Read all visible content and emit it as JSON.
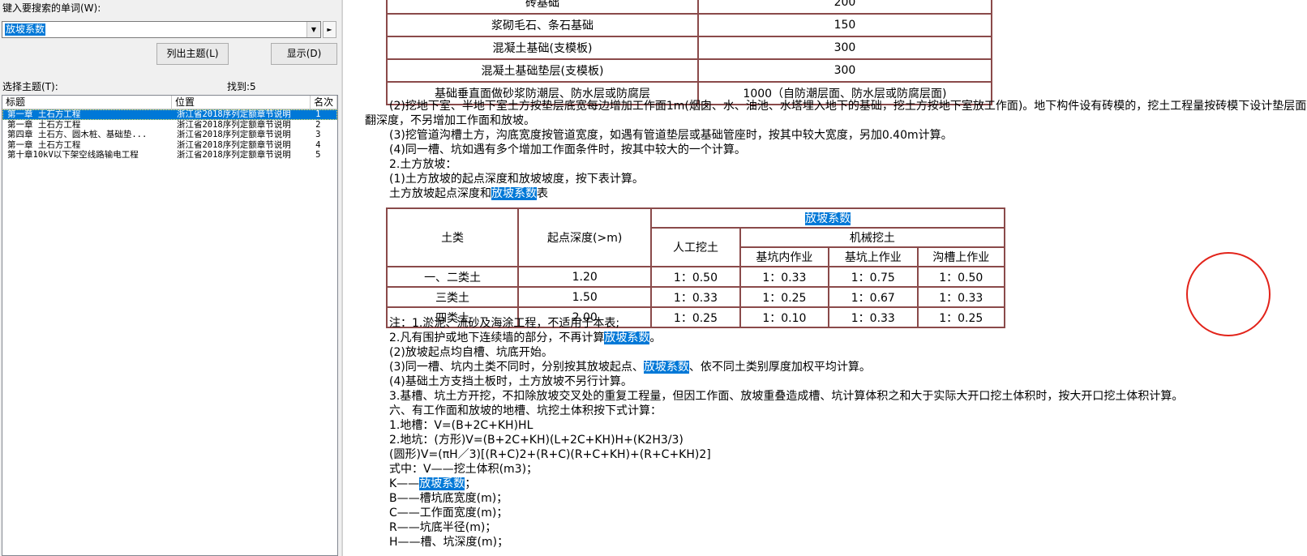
{
  "search": {
    "prompt_label": "键入要搜索的单词(W):",
    "query_value": "放坡系数",
    "dropdown_glyph": "▼",
    "next_glyph": "►",
    "list_topics_button": "列出主题(L)",
    "display_button": "显示(D)"
  },
  "topics": {
    "label": "选择主题(T):",
    "found": "找到:5",
    "columns": [
      "标题",
      "位置",
      "名次"
    ],
    "rows": [
      {
        "title": "第一章 土石方工程",
        "location": "浙江省2018序列定额章节说明",
        "rank": "1",
        "selected": true
      },
      {
        "title": "第一章 土石方工程",
        "location": "浙江省2018序列定额章节说明",
        "rank": "2",
        "selected": false
      },
      {
        "title": "第四章 土石方、圆木桩、基础垫...",
        "location": "浙江省2018序列定额章节说明",
        "rank": "3",
        "selected": false
      },
      {
        "title": "第一章 土石方工程",
        "location": "浙江省2018序列定额章节说明",
        "rank": "4",
        "selected": false
      },
      {
        "title": "第十章10kV以下架空线路输电工程",
        "location": "浙江省2018序列定额章节说明",
        "rank": "5",
        "selected": false
      }
    ]
  },
  "document": {
    "table1": {
      "rows": [
        [
          "砖基础",
          "200"
        ],
        [
          "浆砌毛石、条石基础",
          "150"
        ],
        [
          "混凝土基础(支模板)",
          "300"
        ],
        [
          "混凝土基础垫层(支模板)",
          "300"
        ],
        [
          "基础垂直面做砂浆防潮层、防水层或防腐层",
          "1000（自防潮层面、防水层或防腐层面)"
        ]
      ]
    },
    "para_2": "(2)挖地下室、半地下室土方按垫层底宽每边增加工作面1m(烟囱、水、油池、水塔埋入地下的基础，挖土方按地下室放工作面)。地下构件设有砖模的，挖土工程量按砖模下设计垫层面积乘以砖模下",
    "para_2b": "翻深度，不另增加工作面和放坡。",
    "para_3": "(3)挖管道沟槽土方，沟底宽度按管道宽度，如遇有管道垫层或基础管座时，按其中较大宽度，另加0.40m计算。",
    "para_4": "(4)同一槽、坑如遇有多个增加工作面条件时，按其中较大的一个计算。",
    "para_5": "2.土方放坡：",
    "para_6": "(1)土方放坡的起点深度和放坡坡度，按下表计算。",
    "table2_caption_pre": "土方放坡起点深度和",
    "table2_caption_hl": "放坡系数",
    "table2_caption_post": "表",
    "table2": {
      "h_soil": "土类",
      "h_depth": "起点深度(>m)",
      "h_coef": "放坡系数",
      "h_manual": "人工挖土",
      "h_mech": "机械挖土",
      "h_pit_in": "基坑内作业",
      "h_pit_on": "基坑上作业",
      "h_trench": "沟槽上作业",
      "rows": [
        [
          "一、二类土",
          "1.20",
          "1：0.50",
          "1：0.33",
          "1：0.75",
          "1：0.50"
        ],
        [
          "三类土",
          "1.50",
          "1：0.33",
          "1：0.25",
          "1：0.67",
          "1：0.33"
        ],
        [
          "四类土",
          "2.00",
          "1：0.25",
          "1：0.10",
          "1：0.33",
          "1：0.25"
        ]
      ]
    },
    "note_1": "注：1.淤泥、流砂及海涂工程，不适用于本表;",
    "note_2_pre": "2.凡有围护或地下连续墙的部分，不再计算",
    "note_2_hl": "放坡系数",
    "note_2_post": "。",
    "note_3": "(2)放坡起点均自槽、坑底开始。",
    "note_4_pre": "(3)同一槽、坑内土类不同时，分别按其放坡起点、",
    "note_4_hl": "放坡系数",
    "note_4_post": "、依不同土类别厚度加权平均计算。",
    "note_5": "(4)基础土方支挡土板时，土方放坡不另行计算。",
    "note_6": "3.基槽、坑土方开挖，不扣除放坡交叉处的重复工程量，但因工作面、放坡重叠造成槽、坑计算体积之和大于实际大开口挖土体积时，按大开口挖土体积计算。",
    "note_7": "六、有工作面和放坡的地槽、坑挖土体积按下式计算：",
    "f1": "1.地槽：V=(B+2C+KH)HL",
    "f2": "2.地坑：(方形)V=(B+2C+KH)(L+2C+KH)H+(K2H3/3)",
    "f3": "(圆形)V=(πH／3)[(R+C)2+(R+C)(R+C+KH)+(R+C+KH)2]",
    "f4": "式中：V——挖土体积(m3)；",
    "f5_pre": "K——",
    "f5_hl": "放坡系数",
    "f5_post": "；",
    "f6": "B——槽坑底宽度(m)；",
    "f7": "C——工作面宽度(m)；",
    "f8": "R——坑底半径(m)；",
    "f9": "H——槽、坑深度(m)；"
  },
  "colors": {
    "highlight": "#0078d7",
    "table_border": "#8a4a4a",
    "annotation_circle": "#e2231a"
  }
}
